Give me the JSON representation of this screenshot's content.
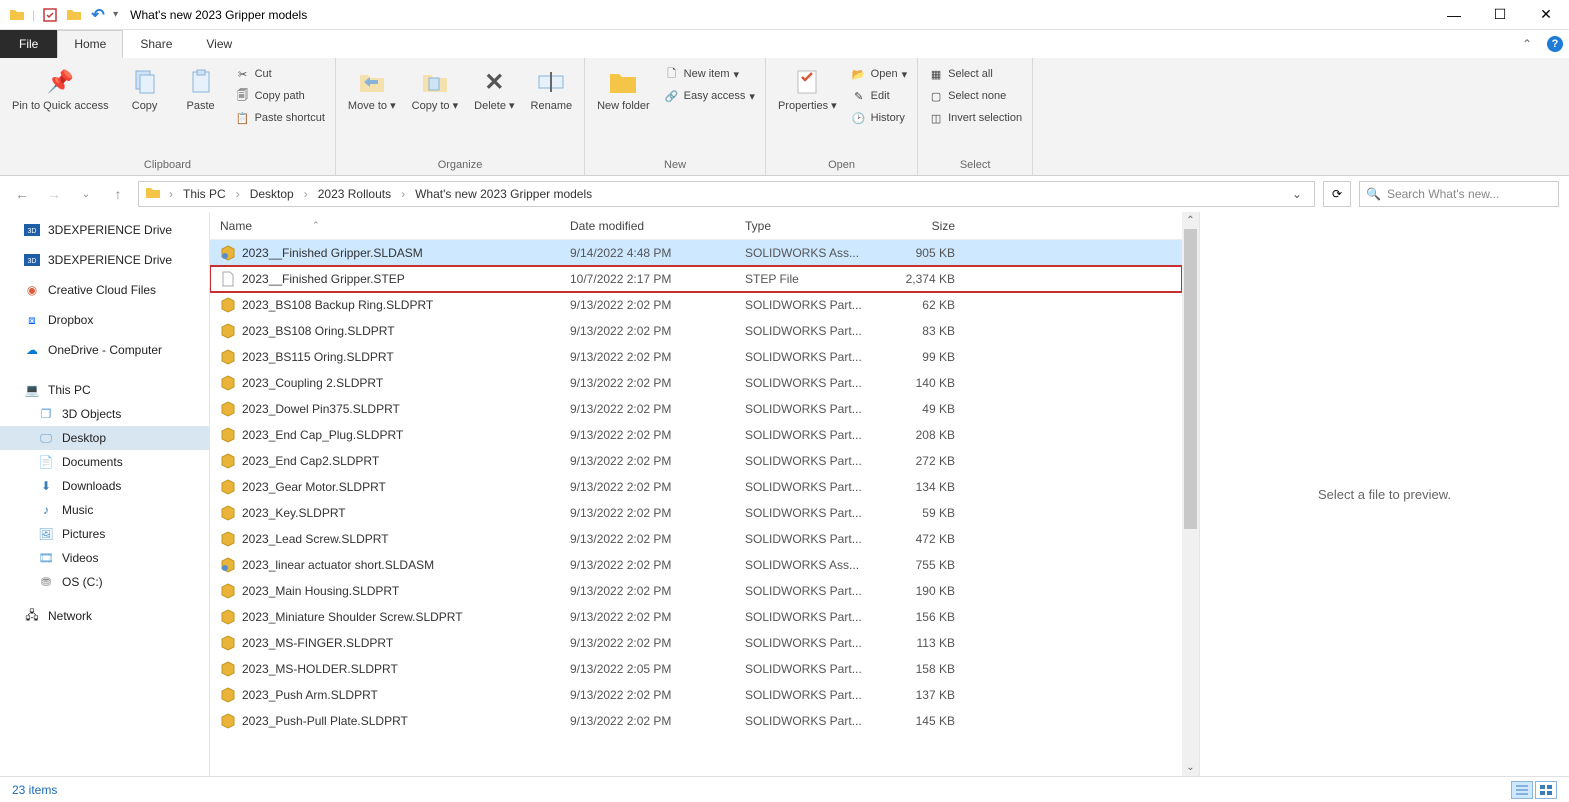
{
  "window_title": "What's new 2023 Gripper models",
  "tabs": {
    "file": "File",
    "home": "Home",
    "share": "Share",
    "view": "View"
  },
  "ribbon": {
    "clipboard": {
      "label": "Clipboard",
      "pin": "Pin to Quick access",
      "copy": "Copy",
      "paste": "Paste",
      "cut": "Cut",
      "copypath": "Copy path",
      "pasteshortcut": "Paste shortcut"
    },
    "organize": {
      "label": "Organize",
      "moveto": "Move to",
      "copyto": "Copy to",
      "delete": "Delete",
      "rename": "Rename"
    },
    "new": {
      "label": "New",
      "newfolder": "New folder",
      "newitem": "New item",
      "easyaccess": "Easy access"
    },
    "open": {
      "label": "Open",
      "properties": "Properties",
      "open": "Open",
      "edit": "Edit",
      "history": "History"
    },
    "select": {
      "label": "Select",
      "selectall": "Select all",
      "selectnone": "Select none",
      "invert": "Invert selection"
    }
  },
  "breadcrumb": [
    "This PC",
    "Desktop",
    "2023 Rollouts",
    "What's new 2023 Gripper models"
  ],
  "search_placeholder": "Search What's new...",
  "nav": {
    "items_top": [
      {
        "label": "3DEXPERIENCE Drive",
        "icon": "3dx"
      },
      {
        "label": "3DEXPERIENCE Drive",
        "icon": "3dx"
      },
      {
        "label": "Creative Cloud Files",
        "icon": "cc"
      },
      {
        "label": "Dropbox",
        "icon": "dropbox"
      },
      {
        "label": "OneDrive - Computer",
        "icon": "onedrive"
      }
    ],
    "thispc": "This PC",
    "thispc_children": [
      {
        "label": "3D Objects",
        "icon": "3dobj"
      },
      {
        "label": "Desktop",
        "icon": "desktop",
        "selected": true
      },
      {
        "label": "Documents",
        "icon": "documents"
      },
      {
        "label": "Downloads",
        "icon": "downloads"
      },
      {
        "label": "Music",
        "icon": "music"
      },
      {
        "label": "Pictures",
        "icon": "pictures"
      },
      {
        "label": "Videos",
        "icon": "videos"
      },
      {
        "label": "OS (C:)",
        "icon": "drive"
      }
    ],
    "network": "Network"
  },
  "columns": {
    "name": "Name",
    "date": "Date modified",
    "type": "Type",
    "size": "Size"
  },
  "files": [
    {
      "name": "2023__Finished Gripper.SLDASM",
      "date": "9/14/2022 4:48 PM",
      "type": "SOLIDWORKS Ass...",
      "size": "905 KB",
      "icon": "asm",
      "selected": true
    },
    {
      "name": "2023__Finished Gripper.STEP",
      "date": "10/7/2022 2:17 PM",
      "type": "STEP File",
      "size": "2,374 KB",
      "icon": "file",
      "highlighted": true
    },
    {
      "name": "2023_BS108 Backup Ring.SLDPRT",
      "date": "9/13/2022 2:02 PM",
      "type": "SOLIDWORKS Part...",
      "size": "62 KB",
      "icon": "part"
    },
    {
      "name": "2023_BS108 Oring.SLDPRT",
      "date": "9/13/2022 2:02 PM",
      "type": "SOLIDWORKS Part...",
      "size": "83 KB",
      "icon": "part"
    },
    {
      "name": "2023_BS115 Oring.SLDPRT",
      "date": "9/13/2022 2:02 PM",
      "type": "SOLIDWORKS Part...",
      "size": "99 KB",
      "icon": "part"
    },
    {
      "name": "2023_Coupling 2.SLDPRT",
      "date": "9/13/2022 2:02 PM",
      "type": "SOLIDWORKS Part...",
      "size": "140 KB",
      "icon": "part"
    },
    {
      "name": "2023_Dowel Pin375.SLDPRT",
      "date": "9/13/2022 2:02 PM",
      "type": "SOLIDWORKS Part...",
      "size": "49 KB",
      "icon": "part"
    },
    {
      "name": "2023_End Cap_Plug.SLDPRT",
      "date": "9/13/2022 2:02 PM",
      "type": "SOLIDWORKS Part...",
      "size": "208 KB",
      "icon": "part"
    },
    {
      "name": "2023_End Cap2.SLDPRT",
      "date": "9/13/2022 2:02 PM",
      "type": "SOLIDWORKS Part...",
      "size": "272 KB",
      "icon": "part"
    },
    {
      "name": "2023_Gear Motor.SLDPRT",
      "date": "9/13/2022 2:02 PM",
      "type": "SOLIDWORKS Part...",
      "size": "134 KB",
      "icon": "part"
    },
    {
      "name": "2023_Key.SLDPRT",
      "date": "9/13/2022 2:02 PM",
      "type": "SOLIDWORKS Part...",
      "size": "59 KB",
      "icon": "part"
    },
    {
      "name": "2023_Lead Screw.SLDPRT",
      "date": "9/13/2022 2:02 PM",
      "type": "SOLIDWORKS Part...",
      "size": "472 KB",
      "icon": "part"
    },
    {
      "name": "2023_linear actuator short.SLDASM",
      "date": "9/13/2022 2:02 PM",
      "type": "SOLIDWORKS Ass...",
      "size": "755 KB",
      "icon": "asm"
    },
    {
      "name": "2023_Main Housing.SLDPRT",
      "date": "9/13/2022 2:02 PM",
      "type": "SOLIDWORKS Part...",
      "size": "190 KB",
      "icon": "part"
    },
    {
      "name": "2023_Miniature Shoulder Screw.SLDPRT",
      "date": "9/13/2022 2:02 PM",
      "type": "SOLIDWORKS Part...",
      "size": "156 KB",
      "icon": "part"
    },
    {
      "name": "2023_MS-FINGER.SLDPRT",
      "date": "9/13/2022 2:02 PM",
      "type": "SOLIDWORKS Part...",
      "size": "113 KB",
      "icon": "part"
    },
    {
      "name": "2023_MS-HOLDER.SLDPRT",
      "date": "9/13/2022 2:05 PM",
      "type": "SOLIDWORKS Part...",
      "size": "158 KB",
      "icon": "part"
    },
    {
      "name": "2023_Push Arm.SLDPRT",
      "date": "9/13/2022 2:02 PM",
      "type": "SOLIDWORKS Part...",
      "size": "137 KB",
      "icon": "part"
    },
    {
      "name": "2023_Push-Pull Plate.SLDPRT",
      "date": "9/13/2022 2:02 PM",
      "type": "SOLIDWORKS Part...",
      "size": "145 KB",
      "icon": "part"
    }
  ],
  "preview_text": "Select a file to preview.",
  "status_text": "23 items"
}
